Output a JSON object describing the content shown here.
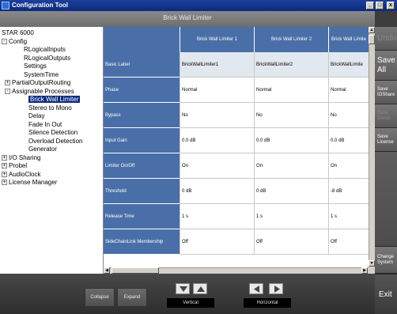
{
  "window": {
    "title": "Configuration Tool",
    "controls": [
      "_",
      "□",
      "x"
    ]
  },
  "panel": {
    "title": "Brick Wall Limiter"
  },
  "tree": {
    "items": [
      {
        "label": "STAR 6000",
        "level": 0,
        "expander": ""
      },
      {
        "label": "Config",
        "level": 0,
        "expander": "-"
      },
      {
        "label": "RLogicalInputs",
        "level": 2,
        "expander": ""
      },
      {
        "label": "RLogicalOutputs",
        "level": 2,
        "expander": ""
      },
      {
        "label": "Settings",
        "level": 2,
        "expander": ""
      },
      {
        "label": "SystemTime",
        "level": 2,
        "expander": ""
      },
      {
        "label": "PartialOutputRouting",
        "level": 1,
        "expander": "+"
      },
      {
        "label": "Assignable Processes",
        "level": 1,
        "expander": "-"
      },
      {
        "label": "Brick Wall Limiter",
        "level": 3,
        "expander": "",
        "selected": true
      },
      {
        "label": "Stereo to Mono",
        "level": 3,
        "expander": ""
      },
      {
        "label": "Delay",
        "level": 3,
        "expander": ""
      },
      {
        "label": "Fade In Out",
        "level": 3,
        "expander": ""
      },
      {
        "label": "Silence Detection",
        "level": 3,
        "expander": ""
      },
      {
        "label": "Overload Detection",
        "level": 3,
        "expander": ""
      },
      {
        "label": "Generator",
        "level": 3,
        "expander": ""
      },
      {
        "label": "I/O Sharing",
        "level": 0,
        "expander": "+"
      },
      {
        "label": "Probel",
        "level": 0,
        "expander": "+"
      },
      {
        "label": "AudioClock",
        "level": 0,
        "expander": "+"
      },
      {
        "label": "License Manager",
        "level": 0,
        "expander": "+"
      }
    ]
  },
  "grid": {
    "columns": [
      "Brick Wall Limiter 1",
      "Brick Wall Limiter 2",
      "Brick Wall Limite"
    ],
    "rows": [
      {
        "label": "Basic Label",
        "values": [
          "BrickWallLimiter1",
          "BrickWallLimiter2",
          "BrickWallLimite"
        ]
      },
      {
        "label": "Phase",
        "values": [
          "Normal",
          "Normal",
          "Normal"
        ]
      },
      {
        "label": "Bypass",
        "values": [
          "No",
          "No",
          "No"
        ]
      },
      {
        "label": "Input Gain",
        "values": [
          "0.0 dB",
          "0.0 dB",
          "0.0 dB"
        ]
      },
      {
        "label": "Limiter On/Off",
        "values": [
          "On",
          "On",
          "On"
        ]
      },
      {
        "label": "Threshold",
        "values": [
          "0 dB",
          "0 dB",
          "-8 dB"
        ]
      },
      {
        "label": "Release Time",
        "values": [
          "1 s",
          "1 s",
          "1 s"
        ]
      },
      {
        "label": "SideChainLink Membership",
        "values": [
          "Off",
          "Off",
          "Off"
        ]
      }
    ]
  },
  "rightcol": {
    "undo": "Undo",
    "save_all_1": "Save",
    "save_all_2": "All",
    "save_io_1": "Save",
    "save_io_2": "IOShare",
    "save_gen_1": "Save",
    "save_gen_2": "Gener",
    "save_lic_1": "Save",
    "save_lic_2": "License",
    "change_1": "Change",
    "change_2": "System"
  },
  "bottom": {
    "collapse": "Collapse",
    "expand": "Expand",
    "vertical": "Vertical",
    "horizontal": "Horizontal",
    "exit": "Exit"
  }
}
